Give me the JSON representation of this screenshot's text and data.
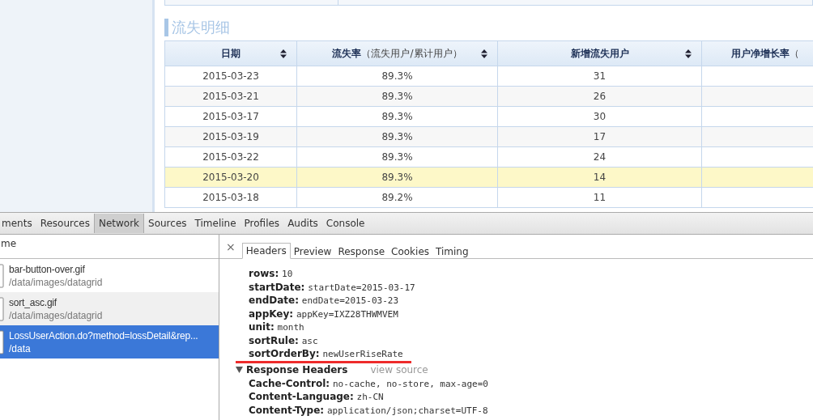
{
  "section_title": "流失明细",
  "table": {
    "columns": [
      {
        "label": "日期",
        "sortable": true
      },
      {
        "label": "流失率",
        "note": "（流失用户/累计用户）",
        "sortable": true
      },
      {
        "label": "新增流失用户",
        "sortable": true
      },
      {
        "label": "用户净增长率",
        "note": "（",
        "sortable": false
      }
    ],
    "rows": [
      {
        "cells": [
          "2015-03-23",
          "89.3%",
          "31"
        ],
        "selected": false
      },
      {
        "cells": [
          "2015-03-21",
          "89.3%",
          "26"
        ],
        "selected": false
      },
      {
        "cells": [
          "2015-03-17",
          "89.3%",
          "30"
        ],
        "selected": false
      },
      {
        "cells": [
          "2015-03-19",
          "89.3%",
          "17"
        ],
        "selected": false
      },
      {
        "cells": [
          "2015-03-22",
          "89.3%",
          "24"
        ],
        "selected": false
      },
      {
        "cells": [
          "2015-03-20",
          "89.3%",
          "14"
        ],
        "selected": true
      },
      {
        "cells": [
          "2015-03-18",
          "89.2%",
          "11"
        ],
        "selected": false
      }
    ]
  },
  "devtools": {
    "tabs": [
      {
        "label": "ments",
        "selected": false
      },
      {
        "label": "Resources",
        "selected": false
      },
      {
        "label": "Network",
        "selected": true
      },
      {
        "label": "Sources",
        "selected": false
      },
      {
        "label": "Timeline",
        "selected": false
      },
      {
        "label": "Profiles",
        "selected": false
      },
      {
        "label": "Audits",
        "selected": false
      },
      {
        "label": "Console",
        "selected": false
      }
    ],
    "list_header": "me",
    "requests": [
      {
        "name": "bar-button-over.gif",
        "path": "/data/images/datagrid",
        "selected": false
      },
      {
        "name": "sort_asc.gif",
        "path": "/data/images/datagrid",
        "selected": false
      },
      {
        "name": "LossUserAction.do?method=lossDetail&rep...",
        "path": "/data",
        "selected": true
      }
    ],
    "close": "×",
    "detail_tabs": [
      {
        "label": "Headers",
        "selected": true
      },
      {
        "label": "Preview",
        "selected": false
      },
      {
        "label": "Response",
        "selected": false
      },
      {
        "label": "Cookies",
        "selected": false
      },
      {
        "label": "Timing",
        "selected": false
      }
    ],
    "params": [
      {
        "name": "rows:",
        "value": "10",
        "marked": false
      },
      {
        "name": "startDate:",
        "value": "startDate=2015-03-17",
        "marked": false
      },
      {
        "name": "endDate:",
        "value": "endDate=2015-03-23",
        "marked": false
      },
      {
        "name": "appKey:",
        "value": "appKey=IXZ28THWMVEM",
        "marked": false
      },
      {
        "name": "unit:",
        "value": "month",
        "marked": false
      },
      {
        "name": "sortRule:",
        "value": "asc",
        "marked": false
      },
      {
        "name": "sortOrderBy:",
        "value": "newUserRiseRate",
        "marked": true
      }
    ],
    "response_section": {
      "title": "Response Headers",
      "expanded": true,
      "link": "view source"
    },
    "response_headers": [
      {
        "name": "Cache-Control:",
        "value": "no-cache, no-store, max-age=0"
      },
      {
        "name": "Content-Language:",
        "value": "zh-CN"
      },
      {
        "name": "Content-Type:",
        "value": "application/json;charset=UTF-8"
      }
    ]
  }
}
